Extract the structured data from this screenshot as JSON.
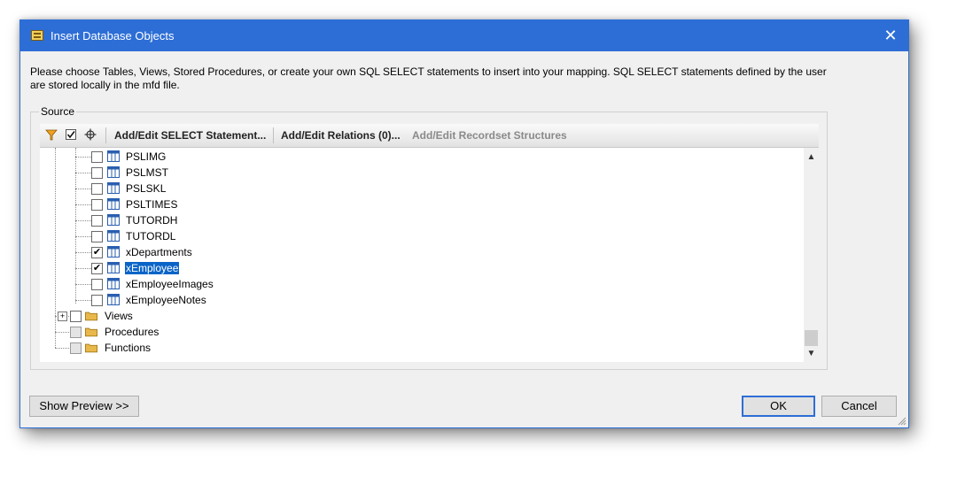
{
  "window": {
    "title": "Insert Database Objects",
    "close_symbol": "✕"
  },
  "description": "Please choose Tables, Views, Stored Procedures, or create your own SQL SELECT statements to insert into your mapping. SQL SELECT statements defined by the user are stored locally in the mfd file.",
  "source": {
    "label": "Source",
    "toolbar": {
      "filter_icon": "filter-icon",
      "check_icon": "checkbox-icon",
      "locate_icon": "crosshair-icon",
      "add_edit_select": "Add/Edit SELECT Statement...",
      "add_edit_relations": "Add/Edit Relations (0)...",
      "add_edit_recordset": "Add/Edit Recordset Structures"
    },
    "tables": [
      {
        "name": "PSLIMG",
        "checked": false,
        "selected": false
      },
      {
        "name": "PSLMST",
        "checked": false,
        "selected": false
      },
      {
        "name": "PSLSKL",
        "checked": false,
        "selected": false
      },
      {
        "name": "PSLTIMES",
        "checked": false,
        "selected": false
      },
      {
        "name": "TUTORDH",
        "checked": false,
        "selected": false
      },
      {
        "name": "TUTORDL",
        "checked": false,
        "selected": false
      },
      {
        "name": "xDepartments",
        "checked": true,
        "selected": false
      },
      {
        "name": "xEmployee",
        "checked": true,
        "selected": true
      },
      {
        "name": "xEmployeeImages",
        "checked": false,
        "selected": false
      },
      {
        "name": "xEmployeeNotes",
        "checked": false,
        "selected": false
      }
    ],
    "folders": [
      {
        "name": "Views",
        "expander": "+"
      },
      {
        "name": "Procedures",
        "expander": ""
      },
      {
        "name": "Functions",
        "expander": ""
      }
    ],
    "check_mark": "✔",
    "scroll_up": "▲",
    "scroll_down": "▼"
  },
  "buttons": {
    "show_preview": "Show Preview >>",
    "ok": "OK",
    "cancel": "Cancel"
  },
  "colors": {
    "titlebar": "#2d6ed6",
    "selection": "#0a64c8",
    "folder": "#e8b84a",
    "table_icon": "#2a5fb0"
  }
}
